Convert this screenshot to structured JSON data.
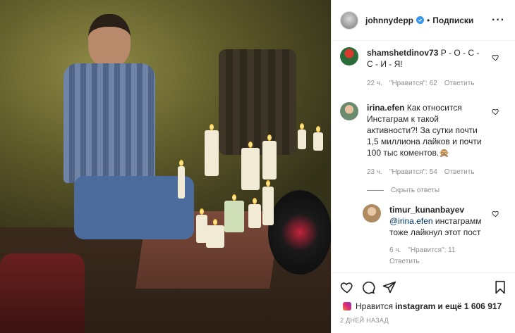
{
  "post": {
    "username": "johnnydepp",
    "follow_dot": "•",
    "follow_label": "Подписки",
    "more_label": "···"
  },
  "comments": [
    {
      "username": "shamshetdinov73",
      "text": "Р - О - С - С - И - Я!",
      "time": "22 ч.",
      "likes": "\"Нравится\": 62",
      "reply_label": "Ответить"
    },
    {
      "username": "irina.efen",
      "text": "Как относится Инстаграм к такой активности?! За сутки почти 1,5 миллиона лайков и почти 100 тыс коментов.🙊",
      "time": "23 ч.",
      "likes": "\"Нравится\": 54",
      "reply_label": "Ответить"
    }
  ],
  "hide_replies_label": "Скрыть ответы",
  "reply": {
    "username": "timur_kunanbayev",
    "mention": "@irina.efen",
    "text": " инстаграмм тоже лайкнул этот пост",
    "time": "6 ч.",
    "likes": "\"Нравится\": 11",
    "reply_label": "Ответить"
  },
  "likes_line": {
    "prefix": "Нравится",
    "account": "instagram",
    "suffix": "и ещё 1 606 917"
  },
  "posted_time": "2 ДНЕЙ НАЗАД",
  "colors": {
    "verified": "#3897f0",
    "meta_gray": "#8e8e8e",
    "link": "#00376b"
  },
  "icons": [
    "heart-icon",
    "comment-icon",
    "share-icon",
    "bookmark-icon",
    "verified-icon",
    "instagram-icon",
    "more-icon"
  ]
}
